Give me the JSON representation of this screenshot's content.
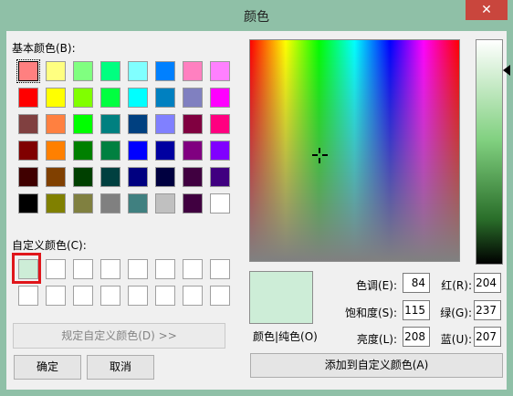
{
  "window": {
    "title": "颜色",
    "close_glyph": "✕"
  },
  "basic_colors_label": "基本颜色(B):",
  "basic_colors": [
    [
      "#ff8080",
      "#ffff80",
      "#80ff80",
      "#00ff80",
      "#80ffff",
      "#0080ff",
      "#ff80c0",
      "#ff80ff"
    ],
    [
      "#ff0000",
      "#ffff00",
      "#80ff00",
      "#00ff40",
      "#00ffff",
      "#0080c0",
      "#8080c0",
      "#ff00ff"
    ],
    [
      "#804040",
      "#ff8040",
      "#00ff00",
      "#008080",
      "#004080",
      "#8080ff",
      "#800040",
      "#ff0080"
    ],
    [
      "#800000",
      "#ff8000",
      "#008000",
      "#008040",
      "#0000ff",
      "#0000a0",
      "#800080",
      "#8000ff"
    ],
    [
      "#400000",
      "#804000",
      "#004000",
      "#004040",
      "#000080",
      "#000040",
      "#400040",
      "#400080"
    ],
    [
      "#000000",
      "#808000",
      "#808040",
      "#808080",
      "#408080",
      "#c0c0c0",
      "#400040",
      "#ffffff"
    ]
  ],
  "custom_colors_label": "自定义颜色(C):",
  "custom_colors": [
    [
      "#cdedd7",
      "#ffffff",
      "#ffffff",
      "#ffffff",
      "#ffffff",
      "#ffffff",
      "#ffffff",
      "#ffffff"
    ],
    [
      "#ffffff",
      "#ffffff",
      "#ffffff",
      "#ffffff",
      "#ffffff",
      "#ffffff",
      "#ffffff",
      "#ffffff"
    ]
  ],
  "buttons": {
    "define_custom": "规定自定义颜色(D) >>",
    "ok": "确定",
    "cancel": "取消",
    "add_custom": "添加到自定义颜色(A)"
  },
  "preview_label": "颜色|纯色(O)",
  "fields": {
    "hue": {
      "label": "色调(E):",
      "value": "84"
    },
    "sat": {
      "label": "饱和度(S):",
      "value": "115"
    },
    "lum": {
      "label": "亮度(L):",
      "value": "208"
    },
    "red": {
      "label": "红(R):",
      "value": "204"
    },
    "green": {
      "label": "绿(G):",
      "value": "237"
    },
    "blue": {
      "label": "蓝(U):",
      "value": "207"
    }
  },
  "selected_color": "#cdedd7"
}
